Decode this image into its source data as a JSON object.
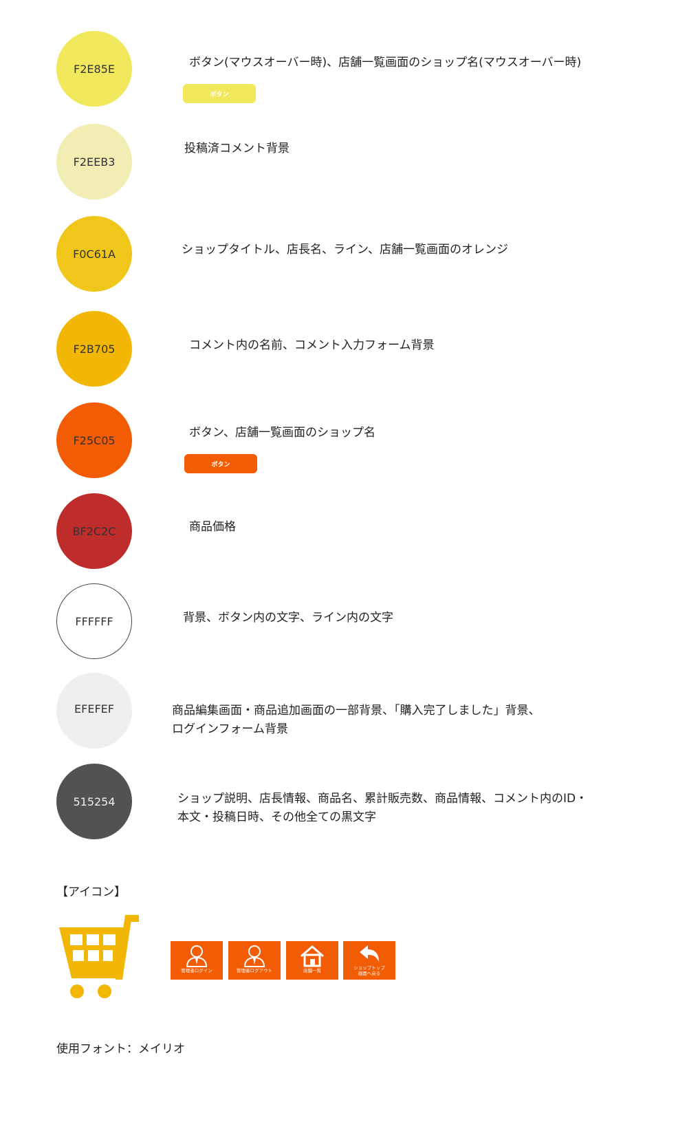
{
  "colors": [
    {
      "code": "F2E85E",
      "hex": "#F2E85E",
      "text_color": "#333333",
      "description": [
        "ボタン(マウスオーバー時)、店舗一覧画面のショップ名(マウスオーバー時)"
      ],
      "sample_button": "ボタン"
    },
    {
      "code": "F2EEB3",
      "hex": "#F2EEB3",
      "text_color": "#333333",
      "description": [
        "投稿済コメント背景"
      ]
    },
    {
      "code": "F0C61A",
      "hex": "#F0C61A",
      "text_color": "#333333",
      "description": [
        "ショップタイトル、店長名、ライン、店舗一覧画面のオレンジ"
      ]
    },
    {
      "code": "F2B705",
      "hex": "#F2B705",
      "text_color": "#333333",
      "description": [
        "コメント内の名前、コメント入力フォーム背景"
      ]
    },
    {
      "code": "F25C05",
      "hex": "#F25C05",
      "text_color": "#333333",
      "description": [
        "ボタン、店舗一覧画面のショップ名"
      ],
      "sample_button": "ボタン"
    },
    {
      "code": "BF2C2C",
      "hex": "#BF2C2C",
      "text_color": "#333333",
      "description": [
        "商品価格"
      ]
    },
    {
      "code": "FFFFFF",
      "hex": "#FFFFFF",
      "text_color": "#333333",
      "description": [
        "背景、ボタン内の文字、ライン内の文字"
      ]
    },
    {
      "code": "EFEFEF",
      "hex": "#EFEFEF",
      "text_color": "#333333",
      "description": [
        "商品編集画面・商品追加画面の一部背景、「購入完了しました」背景、",
        "ログインフォーム背景"
      ]
    },
    {
      "code": "515254",
      "hex": "#515254",
      "text_color": "#EEEEEE",
      "description": [
        "ショップ説明、店長情報、商品名、累計販売数、商品情報、コメント内のID・",
        "本文・投稿日時、その他全ての黒文字"
      ]
    }
  ],
  "icons_section": {
    "title": "【アイコン】",
    "cart_icon": "shopping-cart-icon",
    "cart_color": "#F2B705",
    "buttons": [
      {
        "icon": "admin-user-icon",
        "label": "管理者ログイン"
      },
      {
        "icon": "admin-user-icon",
        "label": "管理者ログアウト"
      },
      {
        "icon": "home-icon",
        "label": "店舗一覧"
      },
      {
        "icon": "back-arrow-icon",
        "label": "ショップトップ\n画面へ戻る"
      }
    ]
  },
  "footer": {
    "font_note": "使用フォント：メイリオ"
  }
}
